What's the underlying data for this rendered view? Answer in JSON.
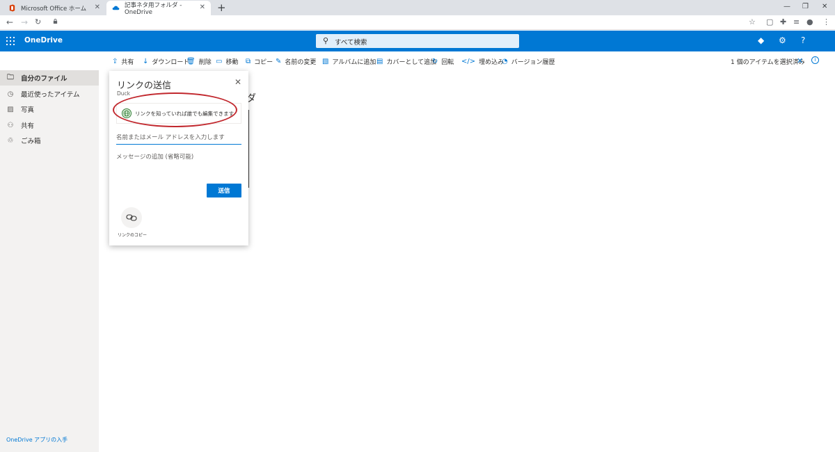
{
  "browser": {
    "tabs": [
      {
        "title": "Microsoft Office ホーム",
        "active": false
      },
      {
        "title": "記事ネタ用フォルダ - OneDrive",
        "active": true
      }
    ],
    "new_tab_icon": "plus-icon",
    "window_controls": [
      "minimize-icon",
      "restore-icon",
      "close-icon"
    ],
    "toolbar_icons": [
      "star-icon",
      "extension-icon",
      "puzzle-icon",
      "queue-icon",
      "profile-icon",
      "menu-icon"
    ]
  },
  "header": {
    "app_name": "OneDrive",
    "search_placeholder": "すべて検索",
    "icons": [
      "diamond-icon",
      "gear-icon",
      "help-icon"
    ],
    "accent_color": "#0078d4"
  },
  "commands": [
    {
      "label": "共有",
      "icon": "share-icon"
    },
    {
      "label": "ダウンロード",
      "icon": "download-icon"
    },
    {
      "label": "削除",
      "icon": "trash-icon"
    },
    {
      "label": "移動",
      "icon": "move-icon"
    },
    {
      "label": "コピー",
      "icon": "copy-icon"
    },
    {
      "label": "名前の変更",
      "icon": "rename-icon"
    },
    {
      "label": "アルバムに追加",
      "icon": "album-icon"
    },
    {
      "label": "カバーとして追加",
      "icon": "cover-icon"
    },
    {
      "label": "回転",
      "icon": "rotate-icon"
    },
    {
      "label": "埋め込み",
      "icon": "embed-icon"
    },
    {
      "label": "バージョン履歴",
      "icon": "history-icon"
    }
  ],
  "selection": {
    "text": "1 個のアイテムを選択済み"
  },
  "sidebar": {
    "items": [
      {
        "label": "自分のファイル",
        "icon": "folder-icon",
        "active": true
      },
      {
        "label": "最近使ったアイテム",
        "icon": "recent-icon",
        "active": false
      },
      {
        "label": "写真",
        "icon": "photo-icon",
        "active": false
      },
      {
        "label": "共有",
        "icon": "people-icon",
        "active": false
      },
      {
        "label": "ごみ箱",
        "icon": "recycle-icon",
        "active": false
      }
    ],
    "get_app": "OneDrive アプリの入手"
  },
  "background": {
    "title_fragment": "ダ"
  },
  "dialog": {
    "title": "リンクの送信",
    "subtitle": "Duck",
    "permission": "リンクを知っていれば誰でも編集できます",
    "name_placeholder": "名前またはメール アドレスを入力します",
    "message_placeholder": "メッセージの追加 (省略可能)",
    "send_label": "送信",
    "copy_label": "リンクのコピー",
    "highlight_color": "#c1272d"
  }
}
